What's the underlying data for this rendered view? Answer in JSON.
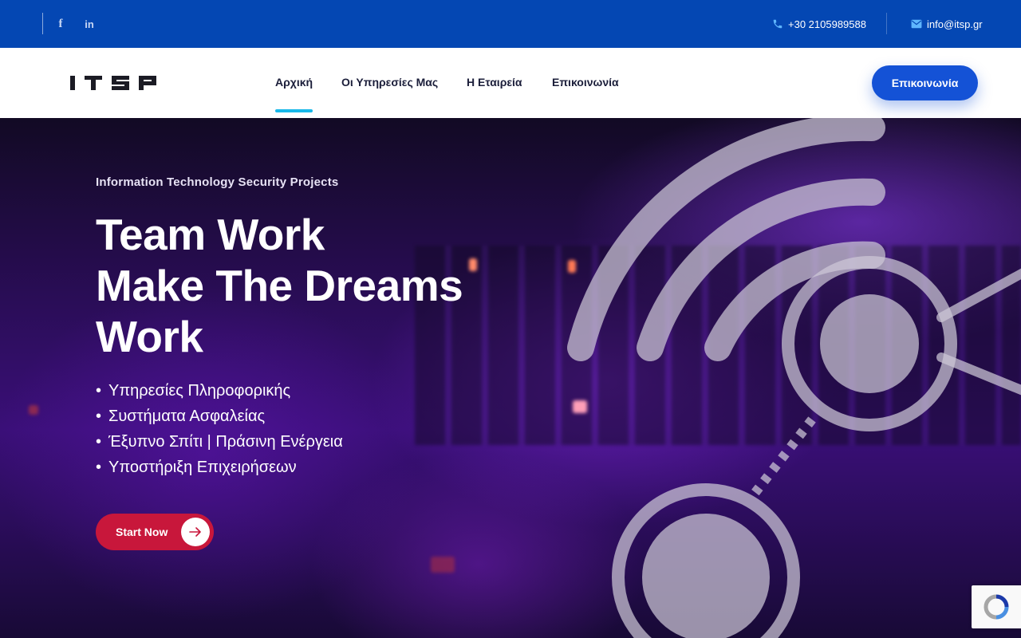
{
  "topbar": {
    "social": [
      {
        "icon": "facebook-icon",
        "glyph": "f"
      },
      {
        "icon": "linkedin-icon",
        "glyph": "in"
      }
    ],
    "phone": "+30 2105989588",
    "email": "info@itsp.gr"
  },
  "nav": {
    "logo": "ITSP",
    "items": [
      "Αρχική",
      "Οι Υπηρεσίες Μας",
      "Η Εταιρεία",
      "Επικοινωνία"
    ],
    "active_index": 0,
    "cta_label": "Επικοινωνία"
  },
  "hero": {
    "eyebrow": "Information Technology Security Projects",
    "headline": [
      "Team Work",
      "Make The Dreams",
      "Work"
    ],
    "bullets": [
      "Υπηρεσίες Πληροφορικής",
      "Συστήματα Ασφαλείας",
      "Έξυπνο Σπίτι | Πράσινη Ενέργεια",
      "Υποστήριξη Επιχειρήσεων"
    ],
    "button_label": "Start Now"
  },
  "colors": {
    "topbar": "#0447b3",
    "accent_blue": "#1452d6",
    "underline": "#19b8e9",
    "start_button": "#c8173b",
    "nav_text": "#1b1e3a"
  }
}
